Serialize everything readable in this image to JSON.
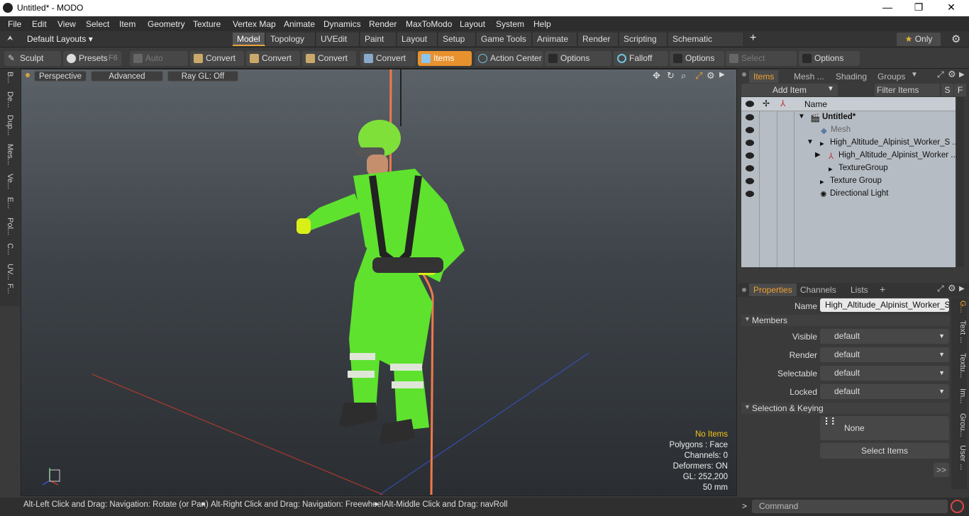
{
  "window": {
    "title": "Untitled* - MODO",
    "minimize": "—",
    "maximize": "❐",
    "close": "✕"
  },
  "menu": [
    "File",
    "Edit",
    "View",
    "Select",
    "Item",
    "Geometry",
    "Texture",
    "Vertex Map",
    "Animate",
    "Dynamics",
    "Render",
    "MaxToModo",
    "Layout",
    "System",
    "Help"
  ],
  "layouts": {
    "dropdown": "Default Layouts",
    "tabs": [
      "Model",
      "Topology",
      "UVEdit",
      "Paint",
      "Layout",
      "Setup",
      "Game Tools",
      "Animate",
      "Render",
      "Scripting",
      "Schematic Fusion"
    ],
    "add": "+",
    "only": "Only"
  },
  "toolbar": {
    "sculpt": "Sculpt",
    "presets": "Presets",
    "presets_key": "F6",
    "auto_select": "Auto Select",
    "convert1": "Convert",
    "convert2": "Convert",
    "convert3": "Convert",
    "convert4": "Convert",
    "items": "Items",
    "action_center": "Action Center",
    "options1": "Options",
    "falloff": "Falloff",
    "options2": "Options",
    "select_through": "Select Through",
    "options3": "Options"
  },
  "left_tabs": [
    "B...",
    "De...",
    "Dup...",
    "Mes...",
    "Ve...",
    "E...",
    "Pol...",
    "C...",
    "UV...",
    "F..."
  ],
  "viewport": {
    "perspective": "Perspective",
    "advanced": "Advanced",
    "raygl": "Ray GL: Off",
    "stats": {
      "no_items": "No Items",
      "polygons": "Polygons : Face",
      "channels": "Channels: 0",
      "deformers": "Deformers: ON",
      "gl": "GL: 252,200",
      "size": "50 mm"
    }
  },
  "status": {
    "hint1": "Alt-Left Click and Drag: Navigation: Rotate (or Pan)",
    "hint2": "Alt-Right Click and Drag: Navigation: Freewheel",
    "hint3": "Alt-Middle Click and Drag: navRoll"
  },
  "items_panel": {
    "tabs": [
      "Items",
      "Mesh ...",
      "Shading",
      "Groups"
    ],
    "add_item": "Add Item",
    "filter": "Filter Items",
    "s": "S",
    "f": "F",
    "col_name": "Name",
    "rows": [
      {
        "label": "Untitled*"
      },
      {
        "label": "Mesh"
      },
      {
        "label": "High_Altitude_Alpinist_Worker_S ..."
      },
      {
        "label": "High_Altitude_Alpinist_Worker ..."
      },
      {
        "label": "TextureGroup"
      },
      {
        "label": "Texture Group"
      },
      {
        "label": "Directional Light"
      }
    ]
  },
  "properties": {
    "tabs": [
      "Properties",
      "Channels",
      "Lists"
    ],
    "add": "+",
    "name_label": "Name",
    "name_value": "High_Altitude_Alpinist_Worker_Sus",
    "members": "Members",
    "visible_label": "Visible",
    "visible_value": "default",
    "render_label": "Render",
    "render_value": "default",
    "selectable_label": "Selectable",
    "selectable_value": "default",
    "locked_label": "Locked",
    "locked_value": "default",
    "selection_keying": "Selection & Keying",
    "none": "None",
    "select_items": "Select Items",
    "more": ">>"
  },
  "side_tabs": [
    "G...",
    "Text ...",
    "Textu...",
    "Im...",
    "Grou...",
    "User ..."
  ],
  "command": {
    "prompt": ">",
    "placeholder": "Command"
  }
}
